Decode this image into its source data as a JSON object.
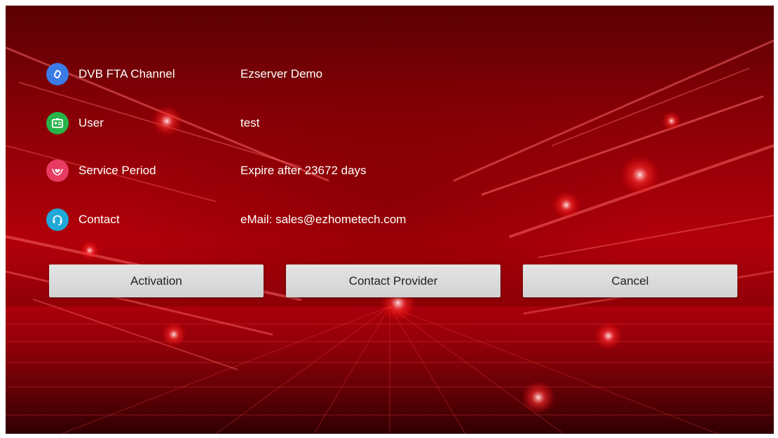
{
  "info_rows": [
    {
      "icon": "link-icon",
      "icon_color": "#3b7be8",
      "label": "DVB FTA Channel",
      "value": "Ezserver Demo"
    },
    {
      "icon": "id-card-icon",
      "icon_color": "#27b34a",
      "label": "User",
      "value": "test"
    },
    {
      "icon": "heart-hands-icon",
      "icon_color": "#e83a62",
      "label": "Service Period",
      "value": "Expire after 23672 days"
    },
    {
      "icon": "headset-icon",
      "icon_color": "#1fa8d8",
      "label": "Contact",
      "value": "eMail: sales@ezhometech.com"
    }
  ],
  "buttons": {
    "activation": "Activation",
    "contact_provider": "Contact Provider",
    "cancel": "Cancel"
  },
  "colors": {
    "background": "#b3000a",
    "text": "#ffffff",
    "button_bg": "#dcdcdc",
    "button_text": "#222222"
  }
}
